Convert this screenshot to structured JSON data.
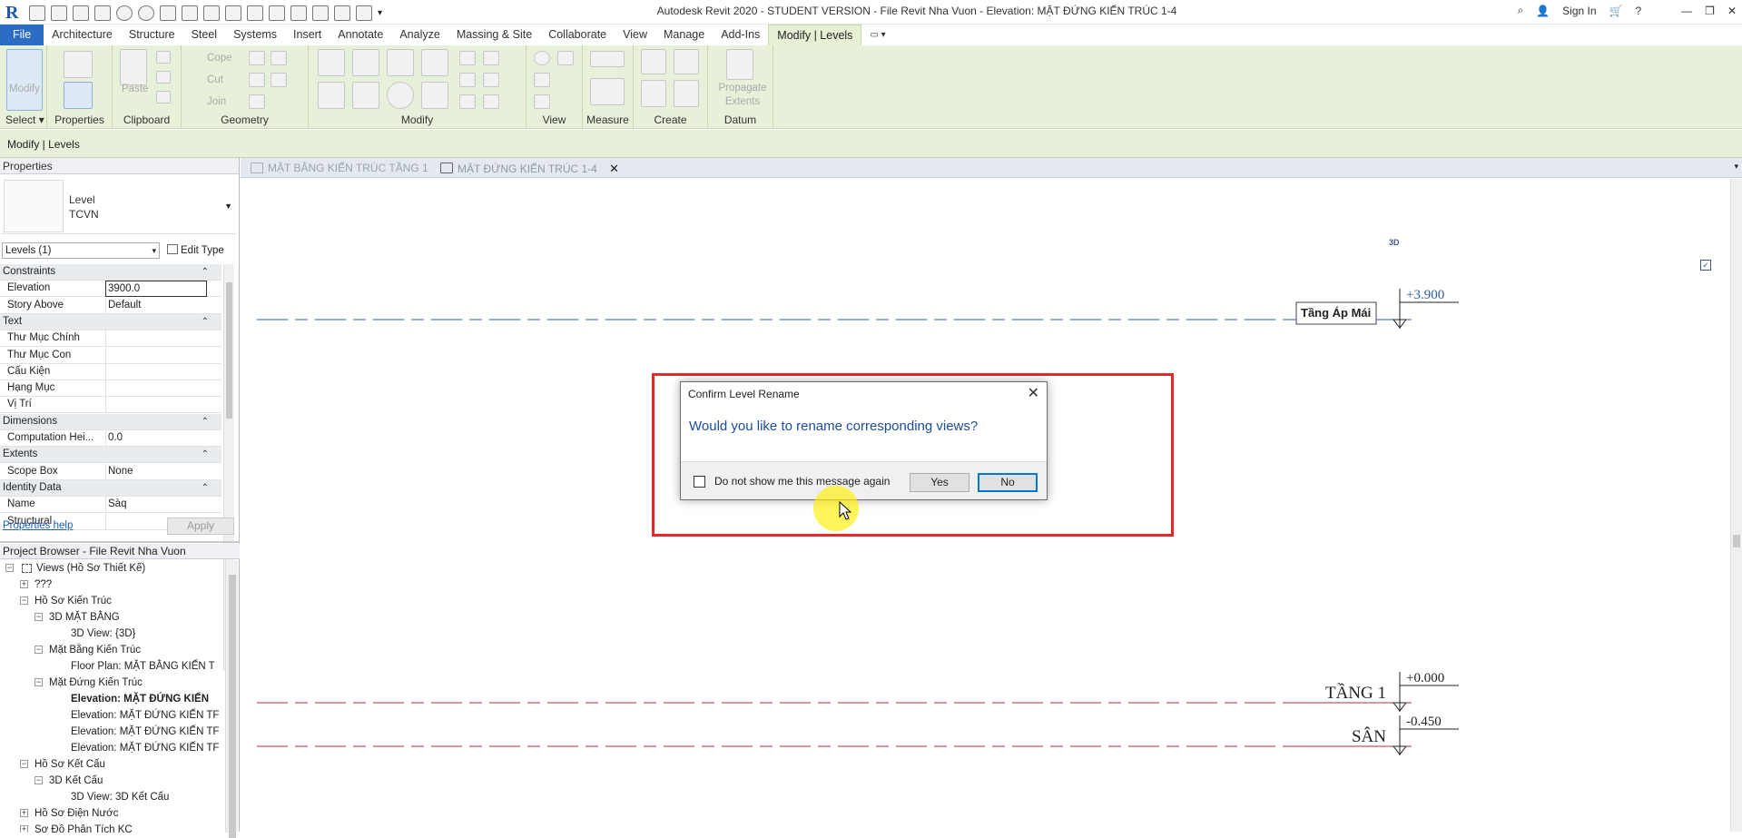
{
  "window": {
    "title": "Autodesk Revit 2020 - STUDENT VERSION - File Revit Nha Vuon - Elevation: MẶT ĐỨNG KIẾN TRÚC 1-4",
    "sign_in": "Sign In"
  },
  "menu": {
    "tabs": [
      "File",
      "Architecture",
      "Structure",
      "Steel",
      "Systems",
      "Insert",
      "Annotate",
      "Analyze",
      "Massing & Site",
      "Collaborate",
      "View",
      "Manage",
      "Add-Ins",
      "Modify | Levels"
    ],
    "active": "Modify | Levels"
  },
  "ribbon": {
    "groups": [
      {
        "label": "Select",
        "dropdown": true
      },
      {
        "label": "Properties"
      },
      {
        "label": "Clipboard"
      },
      {
        "label": "Geometry"
      },
      {
        "label": "Modify"
      },
      {
        "label": "View"
      },
      {
        "label": "Measure"
      },
      {
        "label": "Create"
      },
      {
        "label": "Datum"
      }
    ],
    "modify_label": "Modify",
    "paste_label": "Paste",
    "cope_label": "Cope",
    "cut_label": "Cut",
    "join_label": "Join",
    "propagate_label": "Propagate Extents"
  },
  "context_bar": "Modify | Levels",
  "properties": {
    "header": "Properties",
    "type_family": "Level",
    "type_name": "TCVN",
    "selector": "Levels (1)",
    "edit_type": "Edit Type",
    "rows": [
      {
        "section": "Constraints"
      },
      {
        "key": "Elevation",
        "value": "3900.0"
      },
      {
        "key": "Story Above",
        "value": "Default"
      },
      {
        "section": "Text"
      },
      {
        "key": "Thư Mục Chính",
        "value": ""
      },
      {
        "key": "Thư Mục Con",
        "value": ""
      },
      {
        "key": "Cấu Kiện",
        "value": ""
      },
      {
        "key": "Hạng Mục",
        "value": ""
      },
      {
        "key": "Vị Trí",
        "value": ""
      },
      {
        "section": "Dimensions"
      },
      {
        "key": "Computation Hei...",
        "value": "0.0"
      },
      {
        "section": "Extents"
      },
      {
        "key": "Scope Box",
        "value": "None"
      },
      {
        "section": "Identity Data"
      },
      {
        "key": "Name",
        "value": "Sàq"
      },
      {
        "key": "Structural",
        "value": ""
      }
    ],
    "help": "Properties help",
    "apply": "Apply"
  },
  "browser": {
    "header": "Project Browser - File Revit Nha Vuon",
    "items": [
      {
        "level": 0,
        "toggle": "−",
        "text": "Views (Hồ Sơ Thiết Kế)",
        "icon": true
      },
      {
        "level": 1,
        "toggle": "+",
        "text": "???"
      },
      {
        "level": 1,
        "toggle": "−",
        "text": "Hồ Sơ Kiến Trúc"
      },
      {
        "level": 2,
        "toggle": "−",
        "text": "3D MẶT BẰNG"
      },
      {
        "level": 3,
        "toggle": "",
        "text": "3D View: {3D}"
      },
      {
        "level": 2,
        "toggle": "−",
        "text": "Mặt Bằng Kiến Trúc"
      },
      {
        "level": 3,
        "toggle": "",
        "text": "Floor Plan: MẶT BẰNG KIẾN T"
      },
      {
        "level": 2,
        "toggle": "−",
        "text": "Mặt Đứng Kiến Trúc"
      },
      {
        "level": 3,
        "toggle": "",
        "text": "Elevation: MẶT ĐỨNG KIẾN",
        "bold": true
      },
      {
        "level": 3,
        "toggle": "",
        "text": "Elevation: MẶT ĐỨNG KIẾN TF"
      },
      {
        "level": 3,
        "toggle": "",
        "text": "Elevation: MẶT ĐỨNG KIẾN TF"
      },
      {
        "level": 3,
        "toggle": "",
        "text": "Elevation: MẶT ĐỨNG KIẾN TF"
      },
      {
        "level": 1,
        "toggle": "−",
        "text": "Hồ Sơ Kết Cấu"
      },
      {
        "level": 2,
        "toggle": "−",
        "text": "3D Kết Cấu"
      },
      {
        "level": 3,
        "toggle": "",
        "text": "3D View: 3D Kết Cấu"
      },
      {
        "level": 1,
        "toggle": "+",
        "text": "Hồ Sơ Điện Nước"
      },
      {
        "level": 1,
        "toggle": "+",
        "text": "Sơ Đồ Phân Tích KC"
      }
    ]
  },
  "view_tabs": [
    {
      "label": "MẶT BẰNG KIẾN TRÚC TẦNG 1",
      "active": false
    },
    {
      "label": "MẶT ĐỨNG KIẾN TRÚC 1-4",
      "active": true
    }
  ],
  "canvas": {
    "tag_3d": "3D",
    "levels": [
      {
        "name": "Tầng Áp Mái",
        "elevation": "+3.900",
        "color": "#2a5da8",
        "selected": true
      },
      {
        "name": "TẦNG 1",
        "elevation": "+0.000",
        "color": "#c2243a"
      },
      {
        "name": "SÂN",
        "elevation": "-0.450",
        "color": "#c2243a"
      }
    ]
  },
  "dialog": {
    "title": "Confirm Level Rename",
    "message": "Would you like to rename corresponding views?",
    "checkbox_label": "Do not show me this message again",
    "yes": "Yes",
    "no": "No"
  }
}
